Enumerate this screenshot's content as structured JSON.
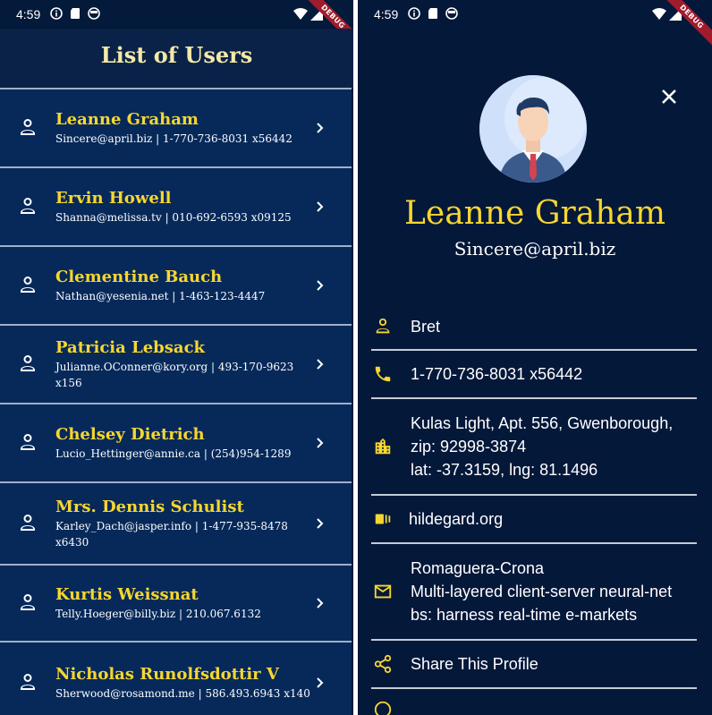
{
  "status": {
    "time": "4:59",
    "debug_banner": "DEBUG"
  },
  "list_screen": {
    "title": "List of Users",
    "users": [
      {
        "name": "Leanne Graham",
        "subtitle": "Sincere@april.biz | 1-770-736-8031 x56442"
      },
      {
        "name": "Ervin Howell",
        "subtitle": "Shanna@melissa.tv | 010-692-6593 x09125"
      },
      {
        "name": "Clementine Bauch",
        "subtitle": "Nathan@yesenia.net | 1-463-123-4447"
      },
      {
        "name": "Patricia Lebsack",
        "subtitle": "Julianne.OConner@kory.org | 493-170-9623 x156"
      },
      {
        "name": "Chelsey Dietrich",
        "subtitle": "Lucio_Hettinger@annie.ca | (254)954-1289"
      },
      {
        "name": "Mrs. Dennis Schulist",
        "subtitle": "Karley_Dach@jasper.info | 1-477-935-8478 x6430"
      },
      {
        "name": "Kurtis Weissnat",
        "subtitle": "Telly.Hoeger@billy.biz | 210.067.6132"
      },
      {
        "name": "Nicholas Runolfsdottir V",
        "subtitle": "Sherwood@rosamond.me | 586.493.6943 x140"
      }
    ]
  },
  "detail_screen": {
    "name": "Leanne Graham",
    "email": "Sincere@april.biz",
    "username": "Bret",
    "phone": "1-770-736-8031 x56442",
    "address_line1": "Kulas Light, Apt. 556, Gwenborough,",
    "address_line2": "zip: 92998-3874",
    "address_line3": "lat: -37.3159, lng: 81.1496",
    "website": "hildegard.org",
    "company_name": "Romaguera-Crona",
    "company_catchphrase": "Multi-layered client-server neural-net",
    "company_bs": "bs: harness real-time e-markets",
    "share_label": "Share This Profile"
  },
  "colors": {
    "accent_yellow": "#f7d62f",
    "background_navy": "#031a3a",
    "card_blue": "#06295a"
  }
}
